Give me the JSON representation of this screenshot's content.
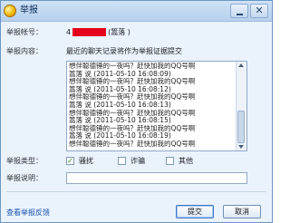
{
  "window": {
    "title": "举报"
  },
  "form": {
    "account_label": "举报帐号：",
    "account_prefix": "4",
    "account_suffix": "(篙落 )",
    "content_label": "举报内容：",
    "content_desc": "最近的聊天记录将作为举报证据提交",
    "chat_log": [
      "想伴聪德锤的一夜吗？赶快加我的QQ号啊",
      "篙落 说 (2011-05-10 16:08:09)",
      "想伴聪德锤的一夜吗？赶快加我的QQ号啊",
      "篙落 说 (2011-05-10 16:08:12)",
      "想伴聪德锤的一夜吗？赶快加我的QQ号啊",
      "篙落 说 (2011-05-10 16:08:13)",
      "想伴聪德锤的一夜吗？赶快加我的QQ号啊",
      "篙落 说 (2011-05-10 16:08:15)",
      "想伴聪德锤的一夜吗？赶快加我的QQ号啊",
      "篙落 说 (2011-05-10 16:08:19)",
      "想伴聪德锤的一夜吗？赶快加我的QQ号啊"
    ],
    "type_label": "举报类型：",
    "types": [
      {
        "label": "骚扰",
        "checked": true
      },
      {
        "label": "诈骗",
        "checked": false
      },
      {
        "label": "其他",
        "checked": false
      }
    ],
    "explain_label": "举报说明："
  },
  "footer": {
    "view_feedback_link": "查看举报反馈",
    "submit_label": "提交",
    "cancel_label": "取消"
  },
  "colors": {
    "redaction": "#e4001a",
    "link": "#1a55b3",
    "accent": "#3d77c8"
  }
}
